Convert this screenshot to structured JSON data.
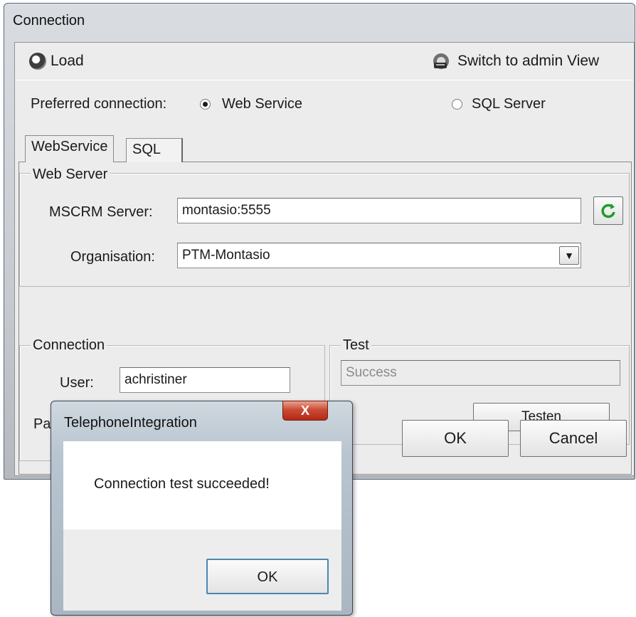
{
  "main_window": {
    "title": "Connection",
    "toolbar": {
      "load_label": "Load",
      "admin_label": "Switch to admin View"
    },
    "preferred": {
      "label": "Preferred connection:",
      "options": [
        {
          "label": "Web Service",
          "selected": true
        },
        {
          "label": "SQL Server",
          "selected": false
        }
      ]
    },
    "tabs": [
      {
        "label": "WebService",
        "active": true
      },
      {
        "label": "SQL",
        "active": false
      }
    ],
    "web_server": {
      "legend": "Web Server",
      "server_label": "MSCRM Server:",
      "server_value": "montasio:5555",
      "org_label": "Organisation:",
      "org_value": "PTM-Montasio"
    },
    "connection": {
      "legend": "Connection",
      "user_label": "User:",
      "user_value": "achristiner",
      "password_label": "Password",
      "password_value": "************"
    },
    "test": {
      "legend": "Test",
      "result_value": "Success",
      "button_label": "Testen"
    },
    "buttons": {
      "ok_label": "OK",
      "cancel_label": "Cancel"
    }
  },
  "dialog": {
    "title": "TelephoneIntegration",
    "close_glyph": "X",
    "message": "Connection test succeeded!",
    "ok_label": "OK"
  },
  "icons": {
    "load": "gear-icon",
    "admin": "admin-switch-icon",
    "refresh": "refresh-icon",
    "dropdown": "chevron-down-icon",
    "close": "close-icon"
  },
  "colors": {
    "refresh_green": "#1e9d2a",
    "close_red": "#c63a22"
  }
}
